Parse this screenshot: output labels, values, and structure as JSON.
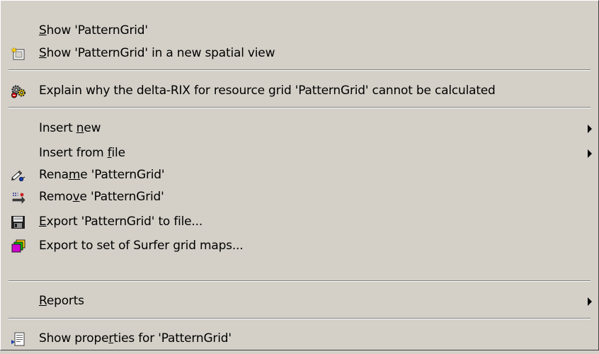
{
  "menu": {
    "items": [
      {
        "pre": "",
        "mn": "S",
        "post": "how 'PatternGrid'",
        "icon": "",
        "submenu": false
      },
      {
        "pre": "",
        "mn": "S",
        "post": "how 'PatternGrid' in a new spatial view",
        "icon": "new-spatial-view-icon",
        "submenu": false
      },
      {
        "pre": "Explain why the delta-RIX for resource grid 'PatternGrid' cannot be calculated",
        "mn": "",
        "post": "",
        "icon": "explain-gears-icon",
        "submenu": false
      },
      {
        "pre": "Insert ",
        "mn": "n",
        "post": "ew",
        "icon": "",
        "submenu": true
      },
      {
        "pre": "Insert from ",
        "mn": "f",
        "post": "ile",
        "icon": "",
        "submenu": true
      },
      {
        "pre": "Rena",
        "mn": "m",
        "post": "e 'PatternGrid'",
        "icon": "rename-pencil-icon",
        "submenu": false
      },
      {
        "pre": "Remo",
        "mn": "v",
        "post": "e 'PatternGrid'",
        "icon": "remove-icon",
        "submenu": false
      },
      {
        "pre": "",
        "mn": "E",
        "post": "xport 'PatternGrid' to file...",
        "icon": "save-disk-icon",
        "submenu": false
      },
      {
        "pre": "Export to set of Surfer grid maps...",
        "mn": "",
        "post": "",
        "icon": "surfer-maps-icon",
        "submenu": false
      },
      {
        "pre": "",
        "mn": "R",
        "post": "eports",
        "icon": "",
        "submenu": true
      },
      {
        "pre": "Show prope",
        "mn": "r",
        "post": "ties for 'PatternGrid'",
        "icon": "properties-document-icon",
        "submenu": false
      }
    ]
  }
}
